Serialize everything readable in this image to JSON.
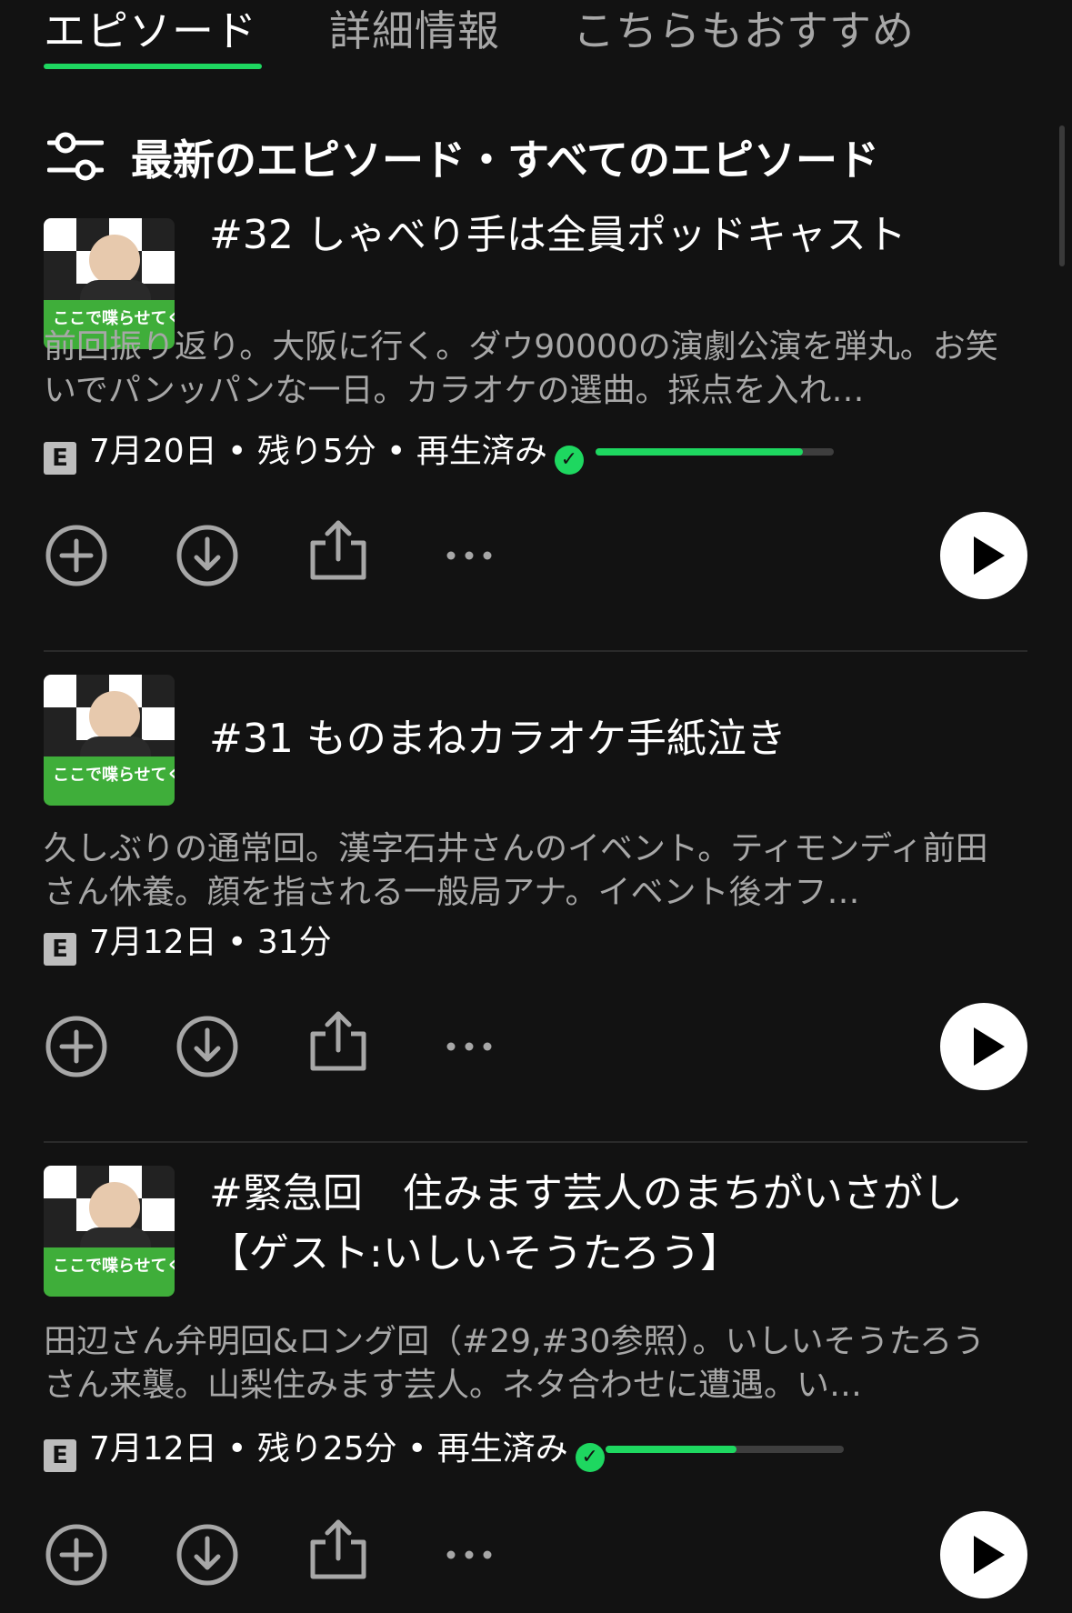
{
  "tabs": [
    {
      "label": "エピソード",
      "active": true
    },
    {
      "label": "詳細情報",
      "active": false
    },
    {
      "label": "こちらもおすすめ",
      "active": false
    }
  ],
  "filter": {
    "label": "最新のエピソード・すべてのエピソード",
    "icon": "sliders-icon"
  },
  "thumbnail_text": "ここで喋らせてください!",
  "accent_color": "#1ed760",
  "episodes": [
    {
      "title": "#32 しゃべり手は全員ポッドキャスト",
      "description": "前回振り返り。大阪に行く。ダウ90000の演劇公演を弾丸。お笑いでパンッパンな一日。カラオケの選曲。採点を入れ…",
      "explicit": "E",
      "meta": "7月20日 • 残り5分 • 再生済み",
      "played": true,
      "progress": 0.87
    },
    {
      "title": "#31 ものまねカラオケ手紙泣き",
      "description": "久しぶりの通常回。漢字石井さんのイベント。ティモンディ前田さん休養。顔を指される一般局アナ。イベント後オフ…",
      "explicit": "E",
      "meta": "7月12日 • 31分",
      "played": false
    },
    {
      "title": "#緊急回　住みます芸人のまちがいさがし",
      "title_line2": "【ゲスト:いしいそうたろう】",
      "description": "田辺さん弁明回&ロング回（#29,#30参照）。いしいそうたろうさん来襲。山梨住みます芸人。ネタ合わせに遭遇。い…",
      "explicit": "E",
      "meta": "7月12日 • 残り25分 • 再生済み",
      "played": true,
      "progress": 0.55
    }
  ]
}
